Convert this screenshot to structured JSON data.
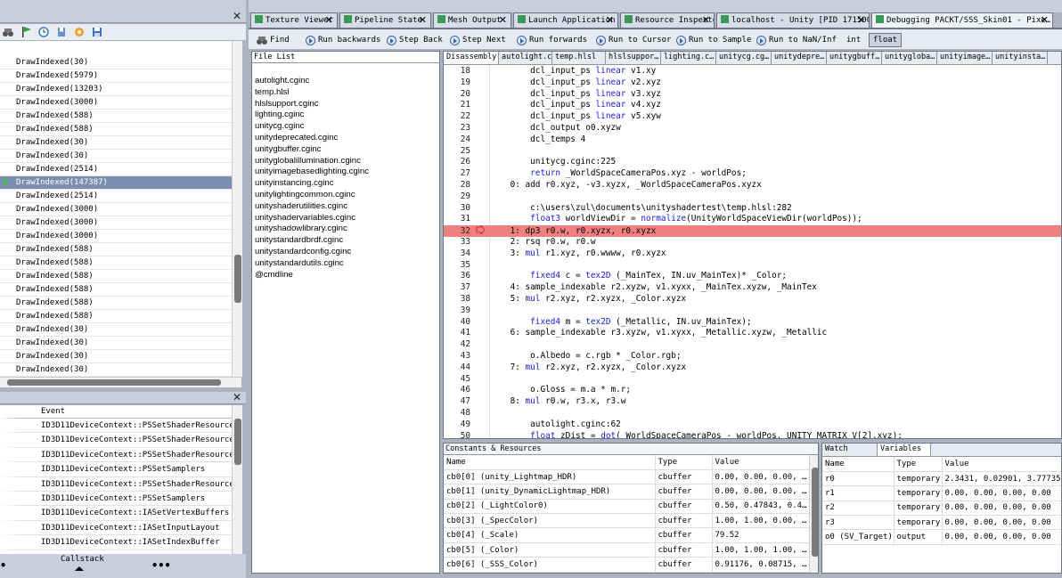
{
  "top_tabs": [
    {
      "label": "Texture Viewer"
    },
    {
      "label": "Pipeline State"
    },
    {
      "label": "Mesh Output"
    },
    {
      "label": "Launch Application"
    },
    {
      "label": "Resource Inspector"
    },
    {
      "label": "localhost - Unity [PID 171500]"
    },
    {
      "label": "Debugging PACKT/SSS_Skin01 - Pixe…"
    }
  ],
  "toolbar": {
    "find": "Find",
    "run_backwards": "Run backwards",
    "step_back": "Step Back",
    "step_next": "Step Next",
    "run_forwards": "Run forwards",
    "run_to_cursor": "Run to Cursor",
    "run_to_sample": "Run to Sample",
    "run_to_nan": "Run to NaN/Inf",
    "int": "int",
    "float": "float"
  },
  "events": [
    "DrawIndexed(30)",
    "DrawIndexed(5979)",
    "DrawIndexed(13203)",
    "DrawIndexed(3000)",
    "DrawIndexed(588)",
    "DrawIndexed(588)",
    "DrawIndexed(30)",
    "DrawIndexed(30)",
    "DrawIndexed(2514)",
    "DrawIndexed(147387)",
    "DrawIndexed(2514)",
    "DrawIndexed(3000)",
    "DrawIndexed(3000)",
    "DrawIndexed(3000)",
    "DrawIndexed(588)",
    "DrawIndexed(588)",
    "DrawIndexed(588)",
    "DrawIndexed(588)",
    "DrawIndexed(588)",
    "DrawIndexed(588)",
    "DrawIndexed(30)",
    "DrawIndexed(30)",
    "DrawIndexed(30)",
    "DrawIndexed(30)"
  ],
  "selected_event_index": 9,
  "api_calls": {
    "header": "Event",
    "items": [
      "ID3D11DeviceContext::PSSetShaderResources",
      "ID3D11DeviceContext::PSSetShaderResources",
      "ID3D11DeviceContext::PSSetShaderResources",
      "ID3D11DeviceContext::PSSetSamplers",
      "ID3D11DeviceContext::PSSetShaderResources",
      "ID3D11DeviceContext::PSSetSamplers",
      "ID3D11DeviceContext::IASetVertexBuffers",
      "ID3D11DeviceContext::IASetInputLayout",
      "ID3D11DeviceContext::IASetIndexBuffer"
    ],
    "callstack": "Callstack",
    "more": "•••"
  },
  "file_list": {
    "title": "File List",
    "items": [
      "autolight.cginc",
      "temp.hlsl",
      "hlslsupport.cginc",
      "lighting.cginc",
      "unitycg.cginc",
      "unitydeprecated.cginc",
      "unitygbuffer.cginc",
      "unityglobalillumination.cginc",
      "unityimagebasedlighting.cginc",
      "unityinstancing.cginc",
      "unitylightingcommon.cginc",
      "unityshaderutilities.cginc",
      "unityshadervariables.cginc",
      "unityshadowlibrary.cginc",
      "unitystandardbrdf.cginc",
      "unitystandardconfig.cginc",
      "unitystandardutils.cginc",
      "@cmdline"
    ]
  },
  "source_tabs": [
    "Disassembly",
    "autolight.c…",
    "temp.hlsl",
    "hlslsuppor…",
    "lighting.c…",
    "unitycg.cg…",
    "unitydepre…",
    "unitygbuff…",
    "unitygloba…",
    "unityimage…",
    "unityinsta…"
  ],
  "code": [
    {
      "n": "18",
      "t": "        dcl_input_ps linear v1.xy"
    },
    {
      "n": "19",
      "t": "        dcl_input_ps linear v2.xyz"
    },
    {
      "n": "20",
      "t": "        dcl_input_ps linear v3.xyz"
    },
    {
      "n": "21",
      "t": "        dcl_input_ps linear v4.xyz"
    },
    {
      "n": "22",
      "t": "        dcl_input_ps linear v5.xyw"
    },
    {
      "n": "23",
      "t": "        dcl_output o0.xyzw"
    },
    {
      "n": "24",
      "t": "        dcl_temps 4"
    },
    {
      "n": "25",
      "t": ""
    },
    {
      "n": "26",
      "t": "        unitycg.cginc:225"
    },
    {
      "n": "27",
      "t": "        return _WorldSpaceCameraPos.xyz - worldPos;"
    },
    {
      "n": "28",
      "t": "    0: add r0.xyz, -v3.xyzx, _WorldSpaceCameraPos.xyzx"
    },
    {
      "n": "29",
      "t": ""
    },
    {
      "n": "30",
      "t": "        c:\\users\\zul\\documents\\unityshadertest\\temp.hlsl:282"
    },
    {
      "n": "31",
      "t": "        float3 worldViewDir = normalize(UnityWorldSpaceViewDir(worldPos));"
    },
    {
      "n": "32",
      "t": "    1: dp3 r0.w, r0.xyzx, r0.xyzx"
    },
    {
      "n": "33",
      "t": "    2: rsq r0.w, r0.w"
    },
    {
      "n": "34",
      "t": "    3: mul r1.xyz, r0.wwww, r0.xyzx"
    },
    {
      "n": "35",
      "t": ""
    },
    {
      "n": "36",
      "t": "        fixed4 c = tex2D (_MainTex, IN.uv_MainTex)* _Color;"
    },
    {
      "n": "37",
      "t": "    4: sample_indexable r2.xyzw, v1.xyxx, _MainTex.xyzw, _MainTex"
    },
    {
      "n": "38",
      "t": "    5: mul r2.xyz, r2.xyzx, _Color.xyzx"
    },
    {
      "n": "39",
      "t": ""
    },
    {
      "n": "40",
      "t": "        fixed4 m = tex2D (_Metallic, IN.uv_MainTex);"
    },
    {
      "n": "41",
      "t": "    6: sample_indexable r3.xyzw, v1.xyxx, _Metallic.xyzw, _Metallic"
    },
    {
      "n": "42",
      "t": ""
    },
    {
      "n": "43",
      "t": "        o.Albedo = c.rgb * _Color.rgb;"
    },
    {
      "n": "44",
      "t": "    7: mul r2.xyz, r2.xyzx, _Color.xyzx"
    },
    {
      "n": "45",
      "t": ""
    },
    {
      "n": "46",
      "t": "        o.Gloss = m.a * m.r;"
    },
    {
      "n": "47",
      "t": "    8: mul r0.w, r3.x, r3.w"
    },
    {
      "n": "48",
      "t": ""
    },
    {
      "n": "49",
      "t": "        autolight.cginc:62"
    },
    {
      "n": "50",
      "t": "        float zDist = dot(_WorldSpaceCameraPos - worldPos, UNITY_MATRIX_V[2].xyz);"
    }
  ],
  "current_line": "32",
  "constants": {
    "title": "Constants & Resources",
    "headers": [
      "Name",
      "Type",
      "Value"
    ],
    "rows": [
      [
        "cb0[0] (unity_Lightmap_HDR)",
        "cbuffer",
        "0.00, 0.00, 0.00, …"
      ],
      [
        "cb0[1] (unity_DynamicLightmap_HDR)",
        "cbuffer",
        "0.00, 0.00, 0.00, …"
      ],
      [
        "cb0[2] (_LightColor0)",
        "cbuffer",
        "0.50, 0.47843, 0.4…"
      ],
      [
        "cb0[3] (_SpecColor)",
        "cbuffer",
        "1.00, 1.00, 0.00, …"
      ],
      [
        "cb0[4] (_Scale)",
        "cbuffer",
        "79.52"
      ],
      [
        "cb0[5] (_Color)",
        "cbuffer",
        "1.00, 1.00, 1.00, …"
      ],
      [
        "cb0[6] (_SSS_Color)",
        "cbuffer",
        "0.91176, 0.08715, …"
      ]
    ]
  },
  "watch_tabs": [
    "Watch",
    "Variables"
  ],
  "variables": {
    "headers": [
      "Name",
      "Type",
      "Value"
    ],
    "rows": [
      [
        "r0",
        "temporary",
        "2.3431, 0.02901, 3.77735, …"
      ],
      [
        "r1",
        "temporary",
        "0.00, 0.00, 0.00, 0.00"
      ],
      [
        "r2",
        "temporary",
        "0.00, 0.00, 0.00, 0.00"
      ],
      [
        "r3",
        "temporary",
        "0.00, 0.00, 0.00, 0.00"
      ],
      [
        "o0 (SV_Target)",
        "output",
        "0.00, 0.00, 0.00, 0.00"
      ]
    ]
  },
  "colors": {
    "highlight": "#f08080",
    "selection": "#7b8db0",
    "keyword": "#1b1bd6"
  }
}
